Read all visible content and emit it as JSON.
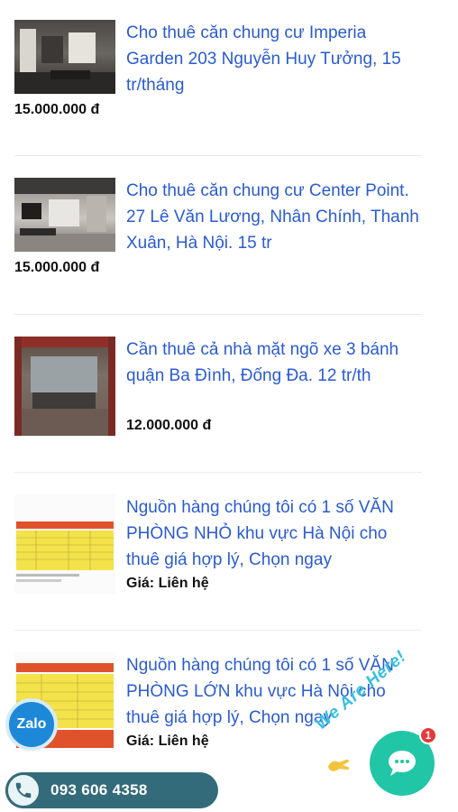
{
  "listings": [
    {
      "title": "Cho thuê căn chung cư Imperia Garden 203 Nguyễn Huy Tưởng, 15 tr/tháng",
      "price": "15.000.000 đ",
      "thumb_icon": "living-room-photo"
    },
    {
      "title": "Cho thuê căn chung cư Center Point. 27 Lê Văn Lương, Nhân Chính, Thanh Xuân, Hà Nội. 15 tr",
      "price": "15.000.000 đ",
      "thumb_icon": "apartment-photo"
    },
    {
      "title": "Cần thuê cả nhà mặt ngõ xe 3 bánh quận Ba Đình, Đống Đa. 12 tr/th",
      "price": "12.000.000 đ",
      "thumb_icon": "house-photo"
    },
    {
      "title": "Nguồn hàng chúng tôi có 1 số VĂN PHÒNG NHỎ khu vực Hà Nội cho thuê giá hợp lý, Chọn ngay",
      "price_label": "Giá:",
      "price_value": "Liên hệ",
      "thumb_icon": "price-sheet-image"
    },
    {
      "title": "Nguồn hàng chúng tôi có 1 số VĂN PHÒNG LỚN khu vực Hà Nội cho thuê giá hợp lý, Chọn ngay",
      "price_label": "Giá:",
      "price_value": "Liên hệ",
      "thumb_icon": "price-sheet-image"
    }
  ],
  "widgets": {
    "zalo_label": "Zalo",
    "phone": "093 606 4358",
    "chat_badge": "1",
    "chat_tagline": "We Are Here!"
  },
  "colors": {
    "link": "#2a5bd1",
    "phone_bar": "#336b7a",
    "chat": "#21c6a7",
    "zalo": "#1e88d8",
    "badge": "#e5393c"
  }
}
